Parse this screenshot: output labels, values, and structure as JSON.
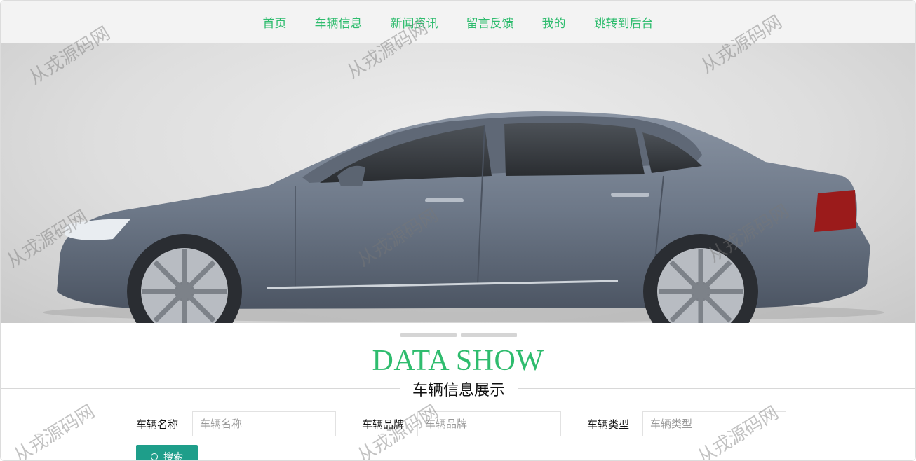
{
  "nav": {
    "items": [
      "首页",
      "车辆信息",
      "新闻资讯",
      "留言反馈",
      "我的",
      "跳转到后台"
    ]
  },
  "banner": {
    "image_desc": "dark grey sedan side view",
    "slide_count": 2
  },
  "section": {
    "title": "DATA SHOW",
    "subtitle": "车辆信息展示"
  },
  "search": {
    "fields": [
      {
        "label": "车辆名称",
        "placeholder": "车辆名称",
        "value": ""
      },
      {
        "label": "车辆品牌",
        "placeholder": "车辆品牌",
        "value": ""
      },
      {
        "label": "车辆类型",
        "placeholder": "车辆类型",
        "value": ""
      }
    ],
    "button_label": "搜索"
  },
  "watermark": "从戎源码网",
  "colors": {
    "accent": "#2fbc6e",
    "button": "#1e9e8a",
    "nav_bg": "#f3f3f3"
  }
}
